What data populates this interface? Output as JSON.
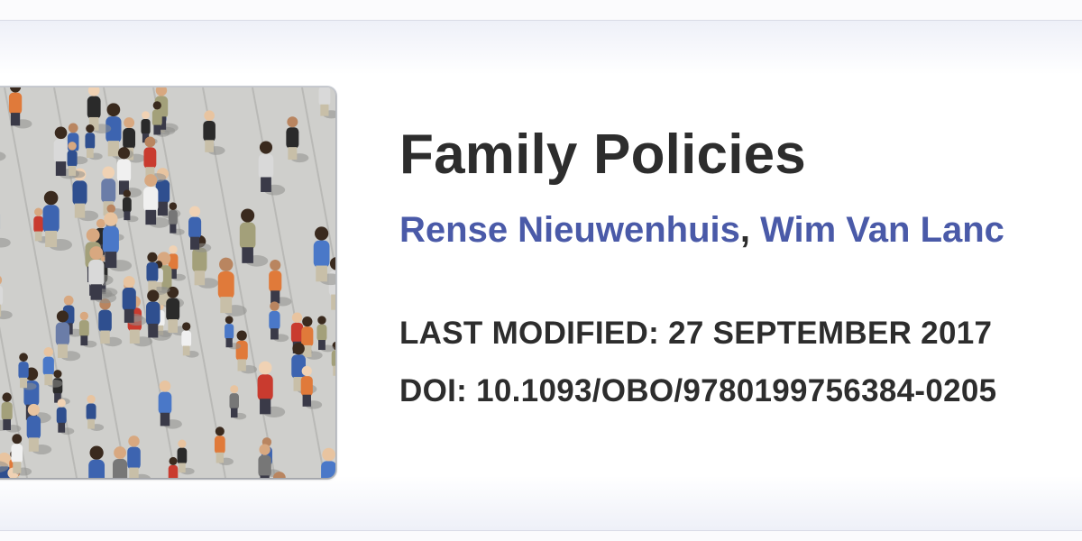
{
  "record": {
    "title": "Family Policies",
    "authors": [
      {
        "name": "Rense Nieuwenhuis"
      },
      {
        "name": "Wim Van Lanc"
      }
    ],
    "author_separator": ", ",
    "last_modified_label": "LAST MODIFIED:",
    "last_modified_value": "27 SEPTEMBER 2017",
    "doi_label": "DOI:",
    "doi_value": "10.1093/OBO/9780199756384-0205"
  },
  "colors": {
    "title": "#2d2d2d",
    "author_link": "#4a5aa8",
    "card_edge": "#eef0f8"
  },
  "image": {
    "subject": "crowd-of-people-walking-photo"
  }
}
